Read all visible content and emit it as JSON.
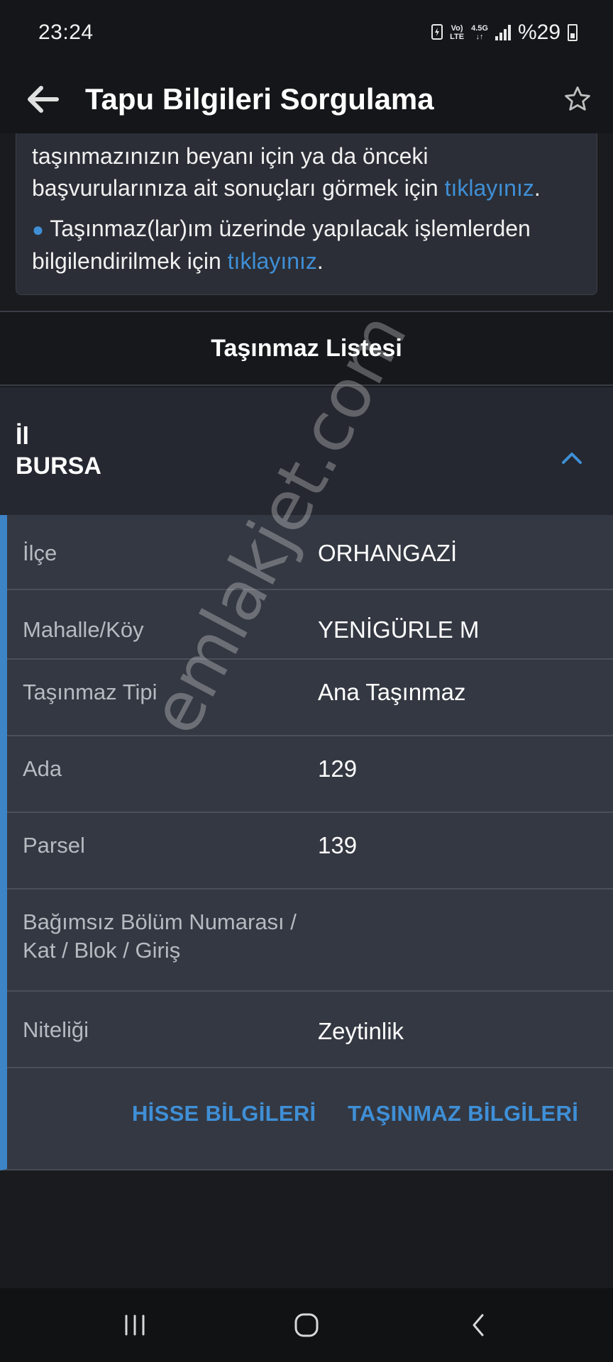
{
  "status_bar": {
    "time": "23:24",
    "network_top": "Vo)",
    "network_bottom": "LTE",
    "network_type": "4.5G",
    "battery": "%29"
  },
  "header": {
    "title": "Tapu Bilgileri Sorgulama",
    "back_icon": "arrow-left-icon",
    "favorite_icon": "star-outline-icon"
  },
  "info": {
    "line1_text": "taşınmazınızın beyanı için ya da önceki başvurularınıza ait sonuçları görmek için ",
    "line1_link": "tıklayınız",
    "line2_text": "Taşınmaz(lar)ım üzerinde yapılacak işlemlerden bilgilendirilmek için ",
    "line2_link": "tıklayınız",
    "period": "."
  },
  "list": {
    "title": "Taşınmaz Listesi",
    "province_label": "İl",
    "province_value": "BURSA",
    "rows": [
      {
        "label": "İlçe",
        "value": "ORHANGAZİ"
      },
      {
        "label": "Mahalle/Köy",
        "value": "YENİGÜRLE M"
      },
      {
        "label": "Taşınmaz Tipi",
        "value": "Ana Taşınmaz"
      },
      {
        "label": "Ada",
        "value": "129"
      },
      {
        "label": "Parsel",
        "value": "139"
      },
      {
        "label": "Bağımsız Bölüm Numarası / Kat / Blok / Giriş",
        "value": ""
      },
      {
        "label": "Niteliği",
        "value": "Zeytinlik"
      }
    ],
    "actions": {
      "share_info": "HİSSE BİLGİLERİ",
      "property_info": "TAŞINMAZ BİLGİLERİ"
    }
  },
  "watermark": "emlakjet.com",
  "colors": {
    "accent": "#3f8fd6",
    "background": "#1a1b1f",
    "card": "#343842"
  }
}
